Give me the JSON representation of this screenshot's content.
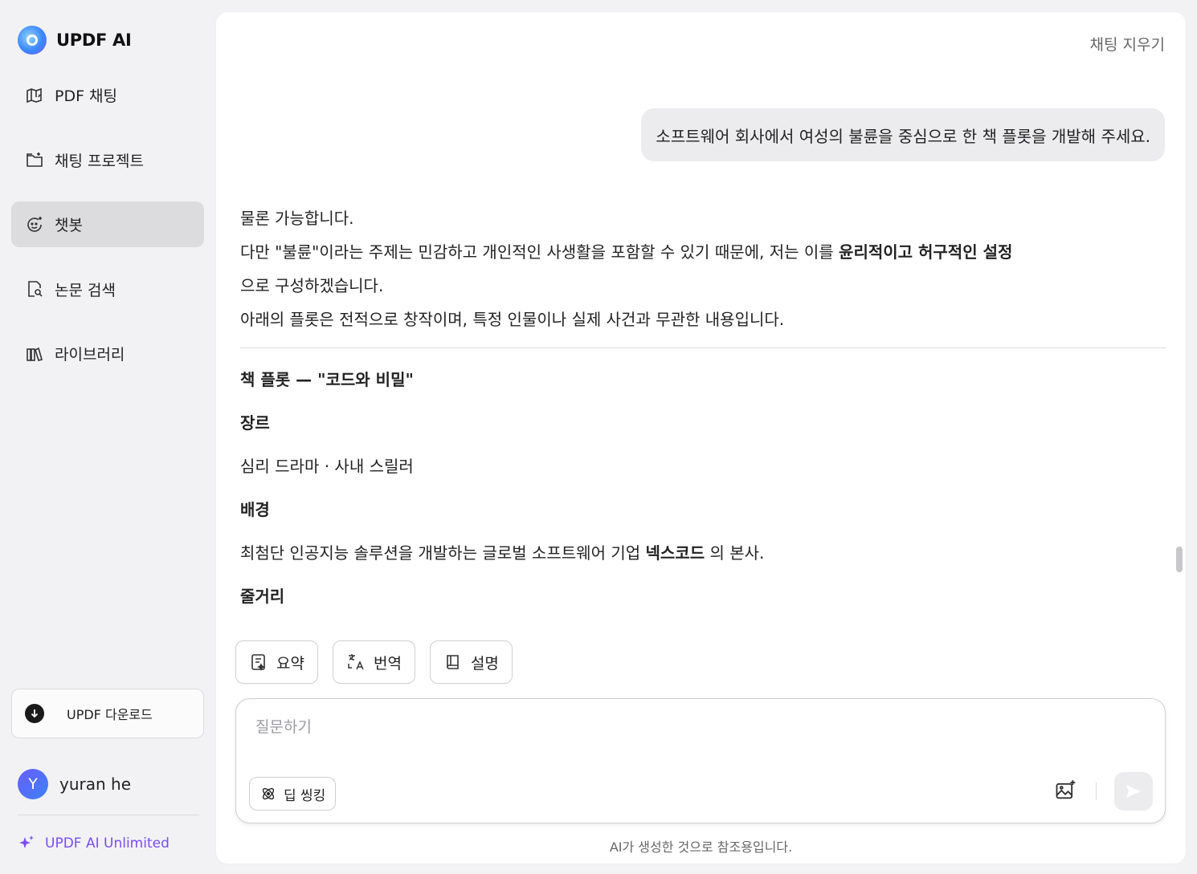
{
  "brand": {
    "title": "UPDF AI"
  },
  "sidebar": {
    "items": [
      {
        "label": "PDF 채팅",
        "icon": "pdf-chat-icon"
      },
      {
        "label": "채팅 프로젝트",
        "icon": "folder-chat-icon"
      },
      {
        "label": "챗봇",
        "icon": "chatbot-icon",
        "active": true
      },
      {
        "label": "논문 검색",
        "icon": "paper-search-icon"
      },
      {
        "label": "라이브러리",
        "icon": "library-icon"
      }
    ],
    "download_label": "UPDF 다운로드",
    "user": {
      "initial": "Y",
      "name": "yuran he"
    },
    "unlimited_label": "UPDF AI Unlimited"
  },
  "chat": {
    "clear_label": "채팅 지우기",
    "user_message": "소프트웨어 회사에서 여성의 불륜을 중심으로 한 책 플롯을 개발해 주세요.",
    "answer": {
      "line1": "물론 가능합니다.",
      "line2_pre": "다만 \"불륜\"이라는 주제는 민감하고 개인적인 사생활을 포함할 수 있기 때문에, 저는 이를 ",
      "line2_bold": "윤리적이고 허구적인 설정",
      "line3": "으로 구성하겠습니다.",
      "line4": "아래의 플롯은 전적으로 창작이며, 특정 인물이나 실제 사건과 무관한 내용입니다.",
      "plot_title": "책 플롯 — \"코드와 비밀\"",
      "genre_heading": "장르",
      "genre_text": "심리 드라마 · 사내 스릴러",
      "setting_heading": "배경",
      "setting_pre": "최첨단 인공지능 솔루션을 개발하는 글로벌 소프트웨어 기업 ",
      "setting_bold": "넥스코드",
      "setting_post": " 의 본사.",
      "story_heading": "줄거리"
    }
  },
  "actions": {
    "summarize": "요약",
    "translate": "번역",
    "explain": "설명"
  },
  "composer": {
    "placeholder": "질문하기",
    "deep_thinking": "딥 씽킹"
  },
  "disclaimer": "AI가 생성한 것으로 참조용입니다.",
  "colors": {
    "accent": "#7a4cf5",
    "active_nav": "#dcdcdf",
    "bubble": "#ececee"
  }
}
